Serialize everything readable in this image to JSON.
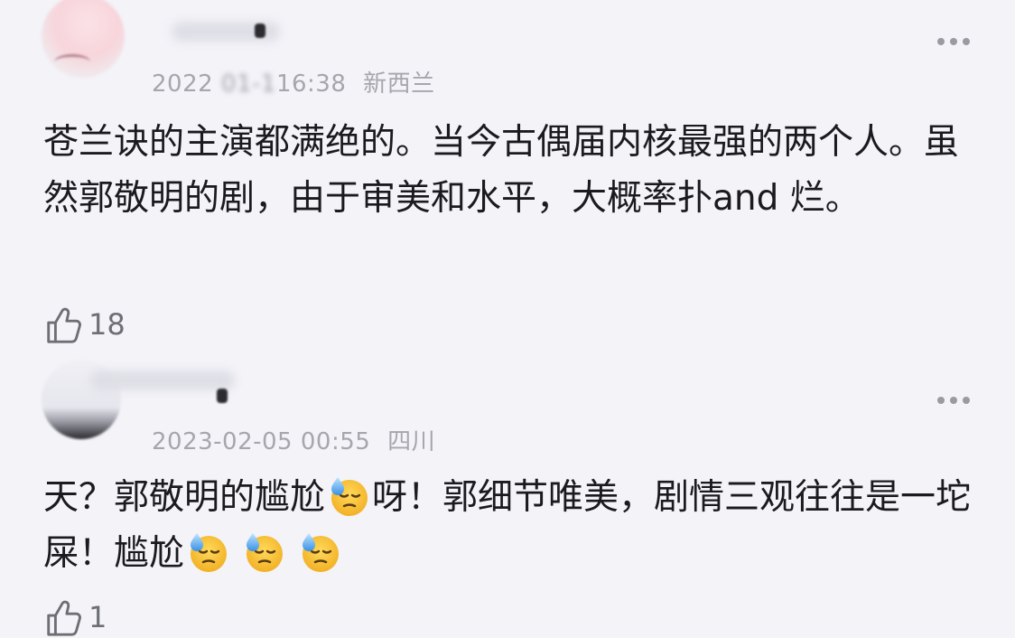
{
  "comments": [
    {
      "meta_visible_start": "2022",
      "meta_redacted": " 01-1",
      "meta_visible_end": "16:38",
      "location": "新西兰",
      "text": "苍兰诀的主演都满绝的。当今古偶届内核最强的两个人。虽然郭敬明的剧，由于审美和水平，大概率扑and 烂。",
      "likes": "18"
    },
    {
      "date": "2023-02-05 00:55",
      "location": "四川",
      "text_parts": [
        "天？郭敬明的尴尬",
        "呀！郭细节唯美，剧情三观往往是一坨屎！尴尬"
      ],
      "likes": "1"
    }
  ],
  "icons": {
    "more": "more-horizontal-icon",
    "like": "thumbs-up-icon",
    "emoji": "downcast-face-with-sweat-emoji"
  },
  "colors": {
    "background": "#f3f3f8",
    "text": "#1b1b1f",
    "meta": "#a6a6ae",
    "emoji_face": "#f7c23a"
  }
}
